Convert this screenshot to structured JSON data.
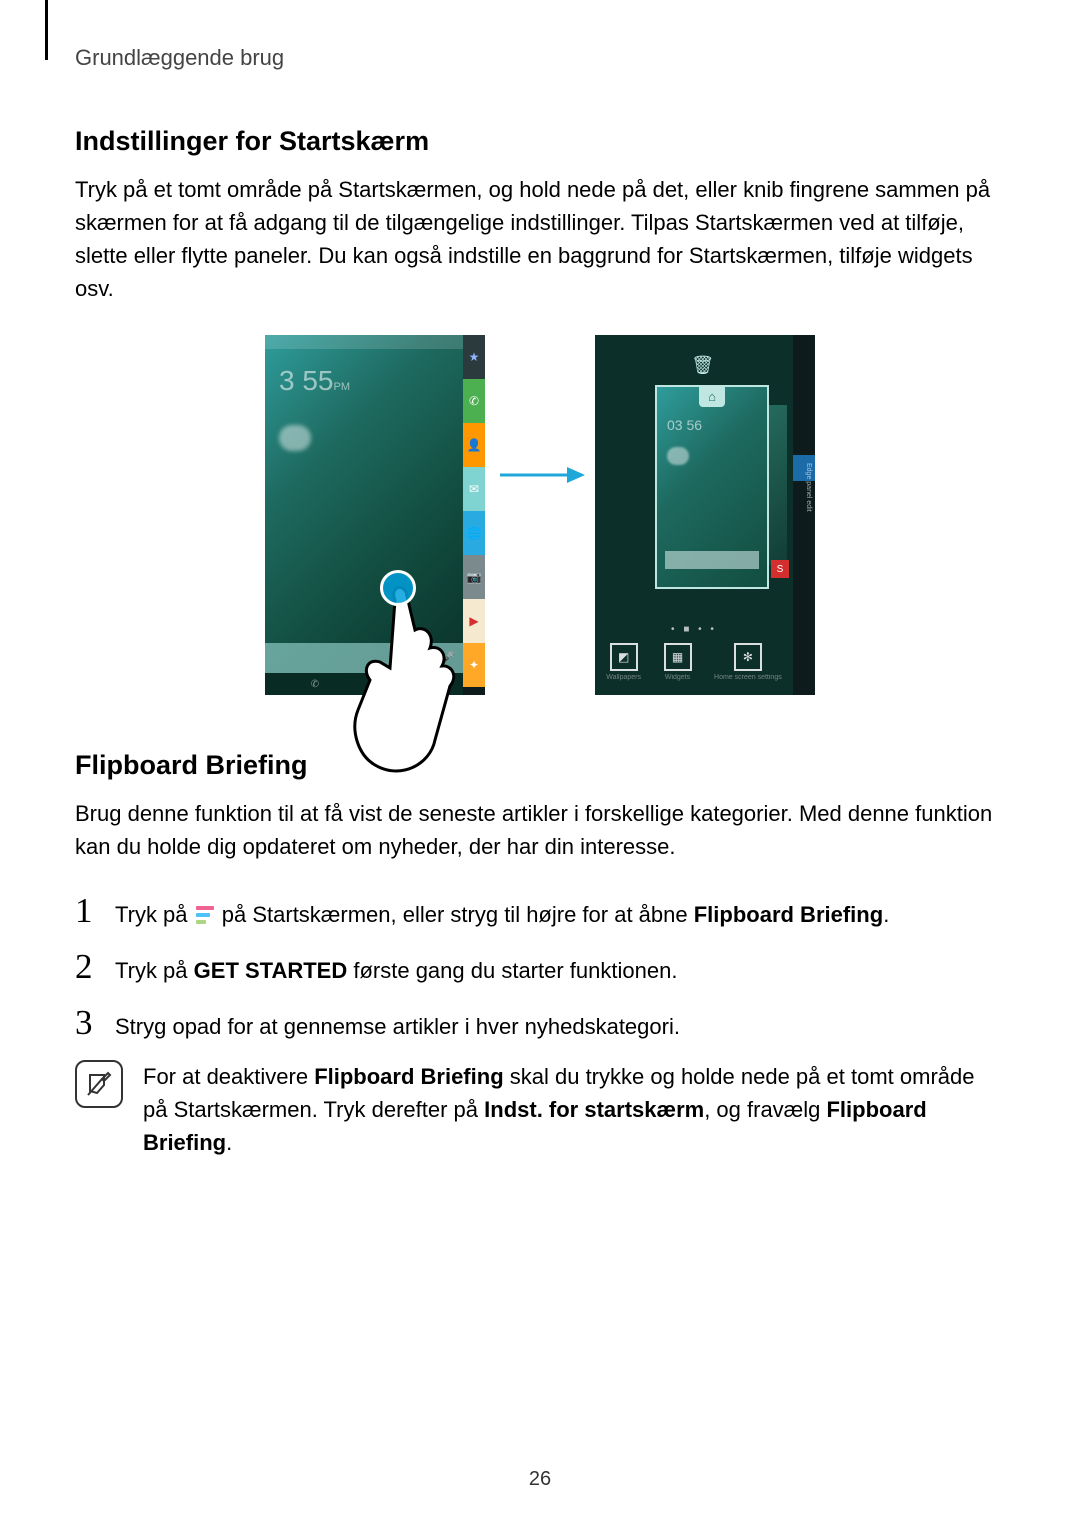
{
  "header": {
    "section": "Grundlæggende brug"
  },
  "section1": {
    "title": "Indstillinger for Startskærm",
    "body": "Tryk på et tomt område på Startskærmen, og hold nede på det, eller knib fingrene sammen på skærmen for at få adgang til de tilgængelige indstillinger. Tilpas Startskærmen ved at tilføje, slette eller flytte paneler. Du kan også indstille en baggrund for Startskærmen, tilføje widgets osv."
  },
  "figure": {
    "phone1": {
      "clock_time": "3 55",
      "clock_ampm": "PM",
      "edge_icons": [
        "star",
        "phone",
        "contact",
        "mail",
        "globe",
        "camera",
        "play",
        "tools"
      ]
    },
    "phone2": {
      "toolbar": [
        {
          "icon": "image",
          "label": "Wallpapers"
        },
        {
          "icon": "grid",
          "label": "Widgets"
        },
        {
          "icon": "gear",
          "label": "Home screen settings"
        }
      ],
      "edit_label": "Edge panel edit"
    }
  },
  "section2": {
    "title": "Flipboard Briefing",
    "body": "Brug denne funktion til at få vist de seneste artikler i forskellige kategorier. Med denne funktion kan du holde dig opdateret om nyheder, der har din interesse.",
    "steps": {
      "s1_a": "Tryk på ",
      "s1_b": " på Startskærmen, eller stryg til højre for at åbne ",
      "s1_c": "Flipboard Briefing",
      "s1_d": ".",
      "s2_a": "Tryk på ",
      "s2_b": "GET STARTED",
      "s2_c": " første gang du starter funktionen.",
      "s3": "Stryg opad for at gennemse artikler i hver nyhedskategori."
    },
    "note": {
      "a": "For at deaktivere ",
      "b": "Flipboard Briefing",
      "c": " skal du trykke og holde nede på et tomt område på Startskærmen. Tryk derefter på ",
      "d": "Indst. for startskærm",
      "e": ", og fravælg ",
      "f": "Flipboard Briefing",
      "g": "."
    }
  },
  "page_number": "26"
}
